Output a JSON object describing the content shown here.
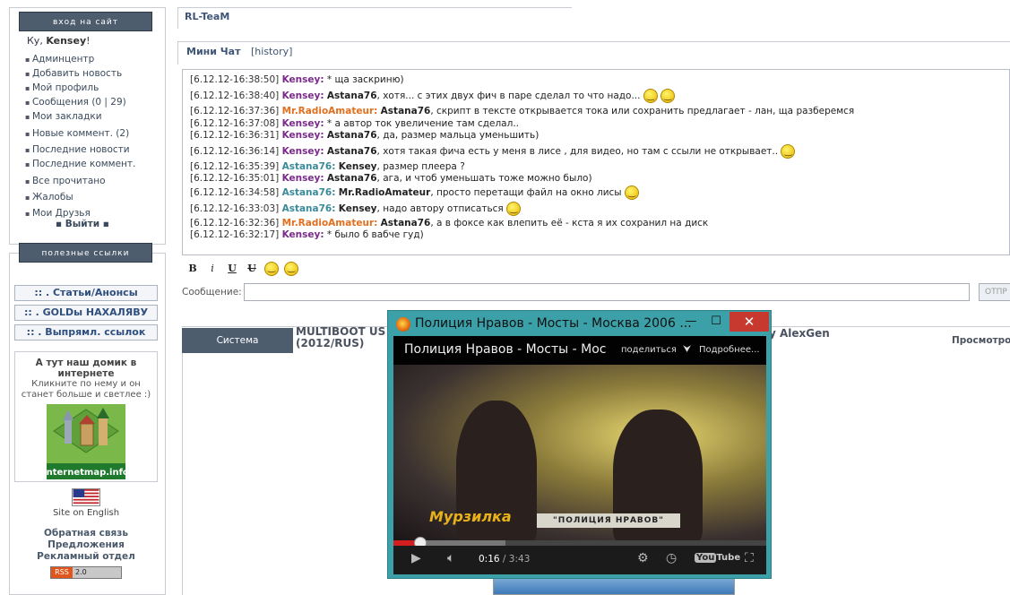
{
  "sidebar": {
    "login_header": "вход на сайт",
    "greeting_prefix": "Ку, ",
    "username": "Kensey",
    "greeting_suffix": "!",
    "menu": [
      "Админцентр",
      "Добавить новость",
      "Мой профиль",
      "Сообщения (0 | 29)",
      "Мои закладки",
      "Новые коммент. (2)",
      "Последние новости",
      "Последние коммент.",
      "Все прочитано",
      "Жалобы",
      "Мои Друзья"
    ],
    "logout": "▪ Выйти ▪",
    "links_header": "полезные ссылки",
    "link_buttons": [
      ":: . Статьи/Анонсы",
      ":: . GOLDы НАХАЛЯВУ",
      ":: . Выпрямл. ссылок"
    ],
    "house_title": "А тут наш домик в интернете",
    "house_sub": "Кликните по нему и он станет больше и светлее :)",
    "house_image_label": "internetmap.info",
    "site_english": "Site on English",
    "info_links": [
      "Обратная связь",
      "Предложения",
      "Рекламный отдел"
    ],
    "rss_a": "RSS",
    "rss_b": "2.0"
  },
  "main": {
    "team_title": "RL-TeaM",
    "chat_title": "Мини Чат",
    "chat_history": "[history]",
    "messages": [
      {
        "ts": "[6.12.12-16:38:50]",
        "user": "Kensey:",
        "user_color": "#7a2a8a",
        "target": "",
        "text": " * ща заскриню)"
      },
      {
        "ts": "[6.12.12-16:38:40]",
        "user": "Kensey:",
        "user_color": "#7a2a8a",
        "target": "Astana76",
        "text": ", хотя... с этих двух фич в паре сделал то что надо..."
      },
      {
        "ts": "[6.12.12-16:37:36]",
        "user": "Mr.RadioAmateur:",
        "user_color": "#e07020",
        "target": "Astana76",
        "text": ", скрипт в тексте открывается тока или сохранить предлагает - лан, ща разберемся"
      },
      {
        "ts": "[6.12.12-16:37:08]",
        "user": "Kensey:",
        "user_color": "#7a2a8a",
        "target": "",
        "text": " * а автор ток увеличение там сделал.."
      },
      {
        "ts": "[6.12.12-16:36:31]",
        "user": "Kensey:",
        "user_color": "#7a2a8a",
        "target": "Astana76",
        "text": ", да, размер мальца уменьшить)"
      },
      {
        "ts": "[6.12.12-16:36:14]",
        "user": "Kensey:",
        "user_color": "#7a2a8a",
        "target": "Astana76",
        "text": ", хотя такая фича есть у меня в лисе , для видео, но там с ссыли не открывает.."
      },
      {
        "ts": "[6.12.12-16:35:39]",
        "user": "Astana76:",
        "user_color": "#3a8a9a",
        "target": "Kensey",
        "text": ", размер плеера ?"
      },
      {
        "ts": "[6.12.12-16:35:01]",
        "user": "Kensey:",
        "user_color": "#7a2a8a",
        "target": "Astana76",
        "text": ", ага, и чтоб уменьшать тоже можно было)"
      },
      {
        "ts": "[6.12.12-16:34:58]",
        "user": "Astana76:",
        "user_color": "#3a8a9a",
        "target": "Mr.RadioAmateur",
        "text": ", просто перетащи файл на окно лисы"
      },
      {
        "ts": "[6.12.12-16:33:03]",
        "user": "Astana76:",
        "user_color": "#3a8a9a",
        "target": "Kensey",
        "text": ", надо автору отписаться"
      },
      {
        "ts": "[6.12.12-16:32:36]",
        "user": "Mr.RadioAmateur:",
        "user_color": "#e07020",
        "target": "Astana76",
        "text": ", а в фоксе как влепить её - кста я их сохранил на диск"
      },
      {
        "ts": "[6.12.12-16:32:17]",
        "user": "Kensey:",
        "user_color": "#7a2a8a",
        "target": "",
        "text": " * было б вабче гуд)"
      }
    ],
    "toolbar": [
      "B",
      "i",
      "U",
      "U"
    ],
    "message_label": "Сообщение:",
    "send_label": "ОТПР",
    "news_tab": "Система",
    "news_title": "MULTIBOOT US\n(2012/RUS)",
    "news_author": "y AlexGen",
    "news_view": "Просмотро"
  },
  "video_window": {
    "title": "Полиция Нравов - Мосты - Москва 2006 ...",
    "min": "—",
    "max": "☐",
    "close": "✕",
    "player_title": "Полиция Нравов - Мосты - Мос",
    "share": "поделиться",
    "more": "Подробнее...",
    "logo_text": "Мурзилка",
    "caption": "\"ПОЛИЦИЯ НРАВОВ\"",
    "time_current": "0:16",
    "time_total": " / 3:43",
    "progress": 0.072,
    "youtube": "You",
    "youtube_tube": "Tube"
  }
}
